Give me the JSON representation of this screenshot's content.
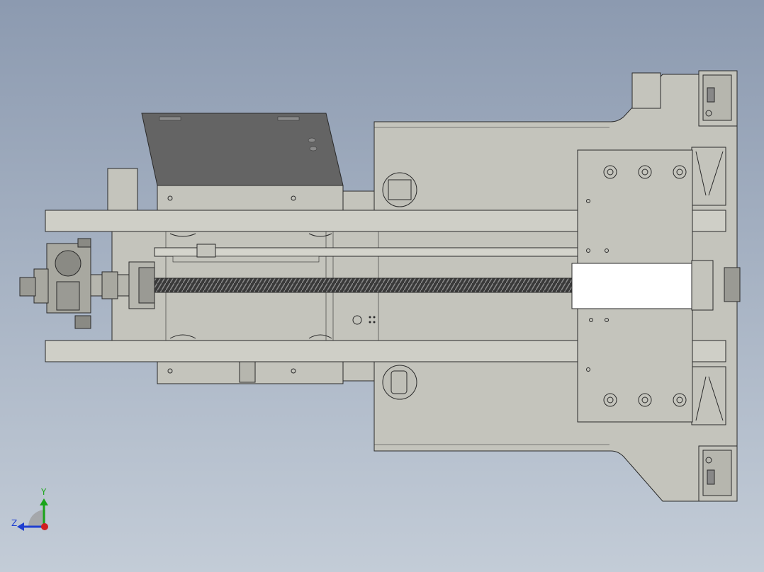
{
  "view": {
    "background_top": "#8c9ab0",
    "background_bottom": "#c3ccd7",
    "part_fill": "#c4c4bc",
    "part_edge": "#2a2a2a",
    "cover_plate_fill": "#646464",
    "highlight_fill": "#ffffff"
  },
  "triad": {
    "y_label": "Y",
    "z_label": "Z",
    "y_color": "#1aa51a",
    "z_color": "#1f3fd0",
    "x_color": "#d01f1f"
  }
}
